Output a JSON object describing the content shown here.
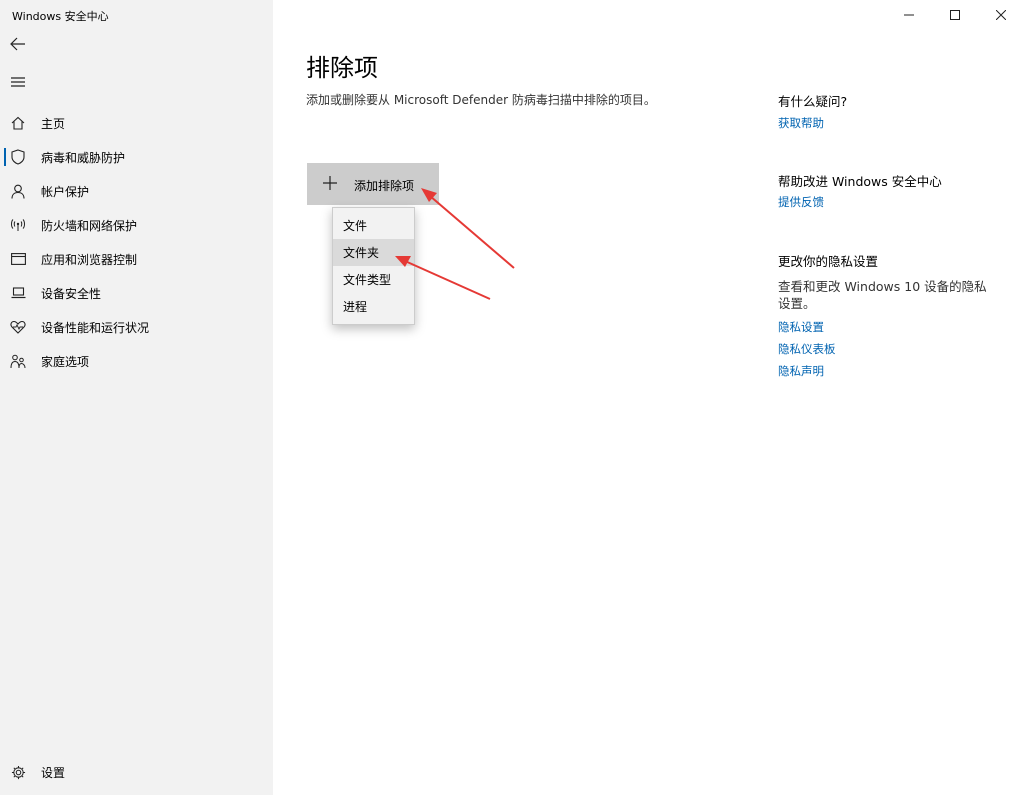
{
  "window": {
    "title": "Windows 安全中心",
    "controls": [
      "minimize",
      "maximize",
      "close"
    ]
  },
  "sidebar": {
    "back_icon": "back-arrow-icon",
    "menu_icon": "hamburger-menu-icon",
    "items": [
      {
        "label": "主页",
        "icon": "home-icon"
      },
      {
        "label": "病毒和威胁防护",
        "icon": "shield-icon",
        "selected": true
      },
      {
        "label": "帐户保护",
        "icon": "person-icon"
      },
      {
        "label": "防火墙和网络保护",
        "icon": "wifi-signal-icon"
      },
      {
        "label": "应用和浏览器控制",
        "icon": "app-window-icon"
      },
      {
        "label": "设备安全性",
        "icon": "laptop-icon"
      },
      {
        "label": "设备性能和运行状况",
        "icon": "heart-icon"
      },
      {
        "label": "家庭选项",
        "icon": "family-icon"
      }
    ],
    "settings": {
      "label": "设置",
      "icon": "gear-icon"
    }
  },
  "main": {
    "title": "排除项",
    "description": "添加或删除要从 Microsoft Defender 防病毒扫描中排除的项目。",
    "add_button": {
      "label": "添加排除项",
      "icon": "plus-icon"
    },
    "dropdown": {
      "items": [
        "文件",
        "文件夹",
        "文件类型",
        "进程"
      ],
      "hovered_index": 1
    }
  },
  "right_pane": {
    "questions": {
      "heading": "有什么疑问?",
      "link": "获取帮助"
    },
    "improve": {
      "heading": "帮助改进 Windows 安全中心",
      "link": "提供反馈"
    },
    "privacy": {
      "heading": "更改你的隐私设置",
      "text": "查看和更改 Windows 10 设备的隐私设置。",
      "links": [
        "隐私设置",
        "隐私仪表板",
        "隐私声明"
      ]
    }
  },
  "colors": {
    "sidebar_bg": "#f2f2f2",
    "accent": "#0063b1",
    "button_bg": "#cccccc",
    "arrow": "#e53935"
  }
}
